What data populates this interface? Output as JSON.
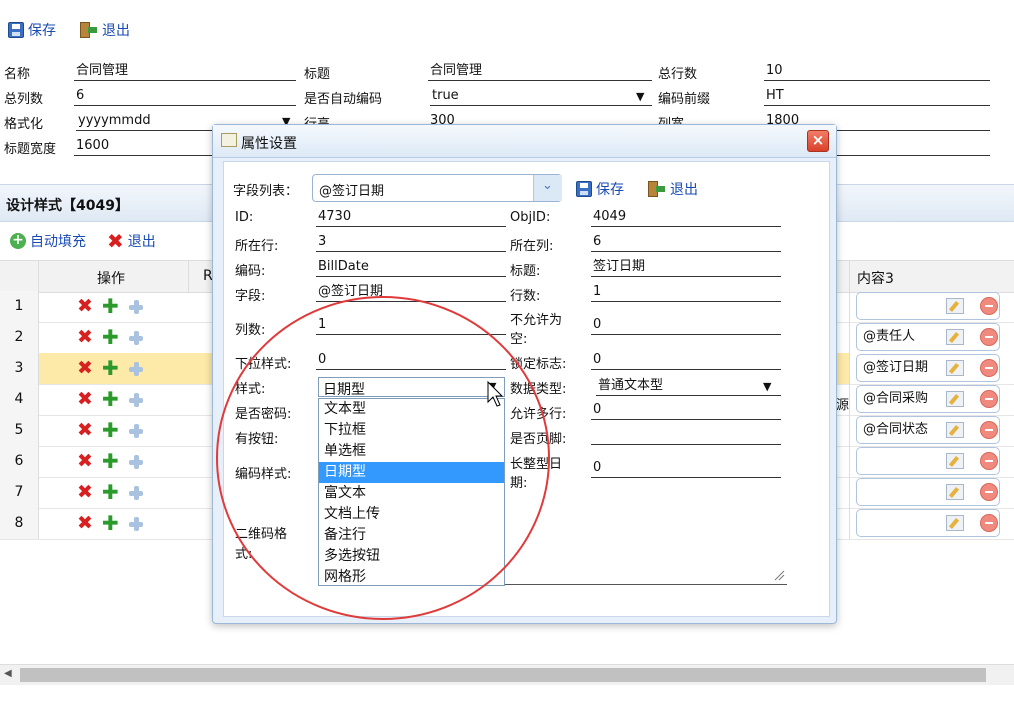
{
  "toolbar": {
    "save": "保存",
    "exit": "退出"
  },
  "form": {
    "name_label": "名称",
    "name_value": "合同管理",
    "title_label": "标题",
    "title_value": "合同管理",
    "total_rows_label": "总行数",
    "total_rows_value": "10",
    "total_cols_label": "总列数",
    "total_cols_value": "6",
    "auto_code_label": "是否自动编码",
    "auto_code_value": "true",
    "code_prefix_label": "编码前缀",
    "code_prefix_value": "HT",
    "format_label": "格式化",
    "format_value": "yyyymmdd",
    "row_height_label": "行高",
    "row_height_value": "300",
    "col_width_label": "列宽",
    "col_width_value": "1800",
    "title_width_label": "标题宽度",
    "title_width_value": "1600"
  },
  "design": {
    "header": "设计样式【4049】",
    "autofill": "自动填充",
    "exit": "退出",
    "col_ops": "操作",
    "col_r": "R",
    "col_content3": "内容3",
    "partial_text": "源",
    "rows": [
      {
        "num": "1",
        "content3": ""
      },
      {
        "num": "2",
        "content3": "@责任人"
      },
      {
        "num": "3",
        "content3": "@签订日期"
      },
      {
        "num": "4",
        "content3": "@合同采购"
      },
      {
        "num": "5",
        "content3": "@合同状态"
      },
      {
        "num": "6",
        "content3": ""
      },
      {
        "num": "7",
        "content3": ""
      },
      {
        "num": "8",
        "content3": ""
      }
    ]
  },
  "dialog": {
    "title": "属性设置",
    "close": "×",
    "field_list_label": "字段列表：",
    "field_list_value": "@签订日期",
    "save": "保存",
    "exit": "退出",
    "id_label": "ID:",
    "id_value": "4730",
    "objid_label": "ObjID:",
    "objid_value": "4049",
    "row_label": "所在行:",
    "row_value": "3",
    "col_label": "所在列:",
    "col_value": "6",
    "code_label": "编码:",
    "code_value": "BillDate",
    "title_label": "标题:",
    "title_value": "签订日期",
    "field_label": "字段:",
    "field_value": "@签订日期",
    "rows_label": "行数:",
    "rows_value": "1",
    "cols_label": "列数:",
    "cols_value": "1",
    "nullable_label_1": "不允许为",
    "nullable_label_2": "空:",
    "nullable_value": "0",
    "dropstyle_label": "下拉样式:",
    "dropstyle_value": "0",
    "lock_label": "锁定标志:",
    "lock_value": "0",
    "style_label": "样式:",
    "style_value": "日期型",
    "datatype_label": "数据类型:",
    "datatype_value": "普通文本型",
    "password_label": "是否密码:",
    "multiline_label": "允许多行:",
    "multiline_value": "0",
    "button_label": "有按钮:",
    "footer_label": "是否页脚:",
    "footer_value": "",
    "codestyle_label": "编码样式:",
    "longdate_label_1": "长整型日",
    "longdate_label_2": "期:",
    "longdate_value": "0",
    "qrcode_label_1": "二维码格",
    "qrcode_label_2": "式:",
    "style_options": [
      "文本型",
      "下拉框",
      "单选框",
      "日期型",
      "富文本",
      "文档上传",
      "备注行",
      "多选按钮",
      "网格形"
    ],
    "style_selected_index": 3
  },
  "colors": {
    "accent": "#1a4bb5",
    "selected_row": "#fde9a8",
    "dropdown_highlight": "#3399ff",
    "annotation_circle": "#e03a3a"
  }
}
